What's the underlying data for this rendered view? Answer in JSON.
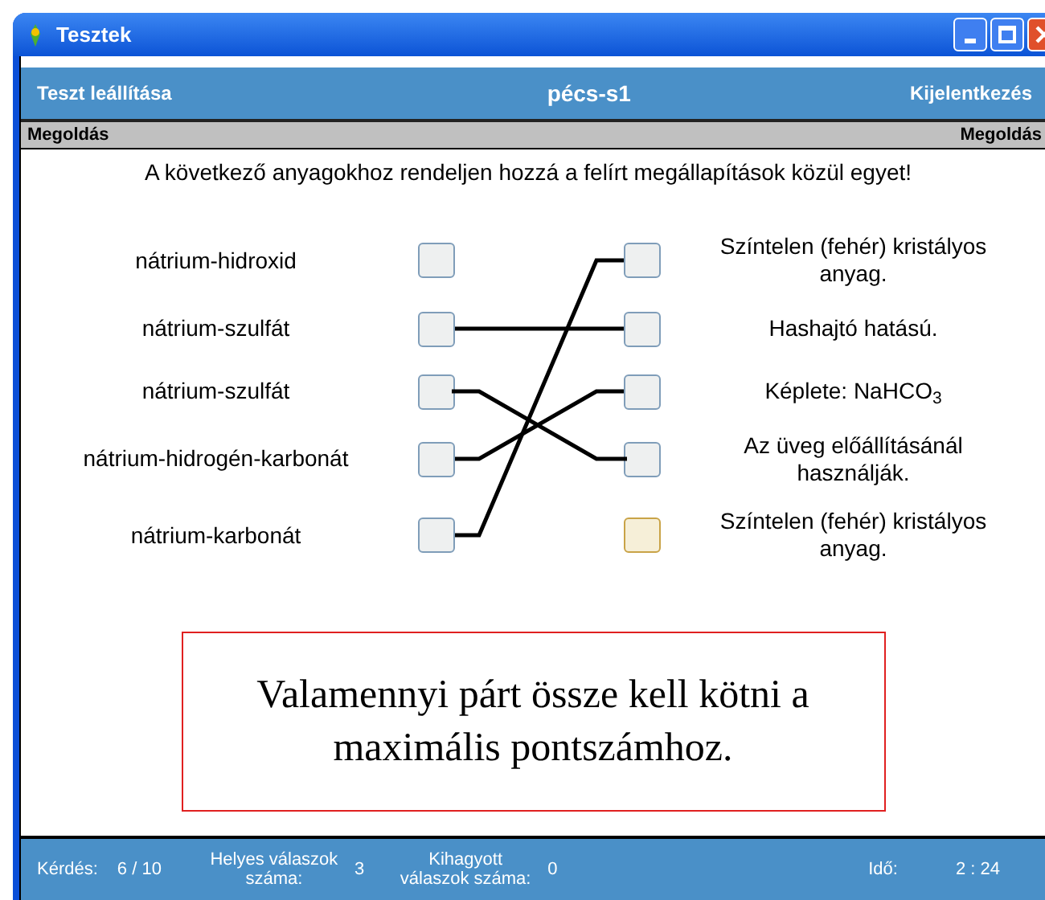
{
  "window": {
    "title": "Tesztek"
  },
  "header": {
    "left": "Teszt leállítása",
    "center": "pécs-s1",
    "right": "Kijelentkezés"
  },
  "subheader": {
    "left": "Megoldás",
    "right": "Megoldás"
  },
  "instruction": "A következő anyagokhoz rendeljen hozzá a felírt megállapítások közül egyet!",
  "left_items": [
    {
      "label": "nátrium-hidroxid",
      "links": [
        false,
        false,
        false,
        false,
        false
      ]
    },
    {
      "label": "nátrium-szulfát",
      "links": [
        false,
        true,
        false,
        false,
        false
      ]
    },
    {
      "label": "nátrium-szulfát",
      "links": [
        false,
        false,
        false,
        true,
        false
      ]
    },
    {
      "label": "nátrium-hidrogén-karbonát",
      "links": [
        false,
        false,
        true,
        false,
        false
      ]
    },
    {
      "label": "nátrium-karbonát",
      "links": [
        true,
        false,
        false,
        false,
        false
      ]
    }
  ],
  "right_items": [
    {
      "label": "Színtelen (fehér) kristályos anyag.",
      "highlighted": false
    },
    {
      "label": "Hashajtó hatású.",
      "highlighted": false
    },
    {
      "label": "Képlete: NaHCO$_{3}$",
      "highlighted": false
    },
    {
      "label": "Az üveg előállításánál használják.",
      "highlighted": false
    },
    {
      "label": "Színtelen (fehér) kristályos anyag.",
      "highlighted": true
    }
  ],
  "notice": "Valamennyi párt össze kell kötni a maximális pontszámhoz.",
  "status_bar": {
    "question_label": "Kérdés:",
    "question_value": "6 / 10",
    "correct_label": "Helyes válaszok száma:",
    "correct_value": "3",
    "skipped_label": "Kihagyott válaszok száma:",
    "skipped_value": "0",
    "time_label": "Idő:",
    "time_value": "2 : 24"
  }
}
